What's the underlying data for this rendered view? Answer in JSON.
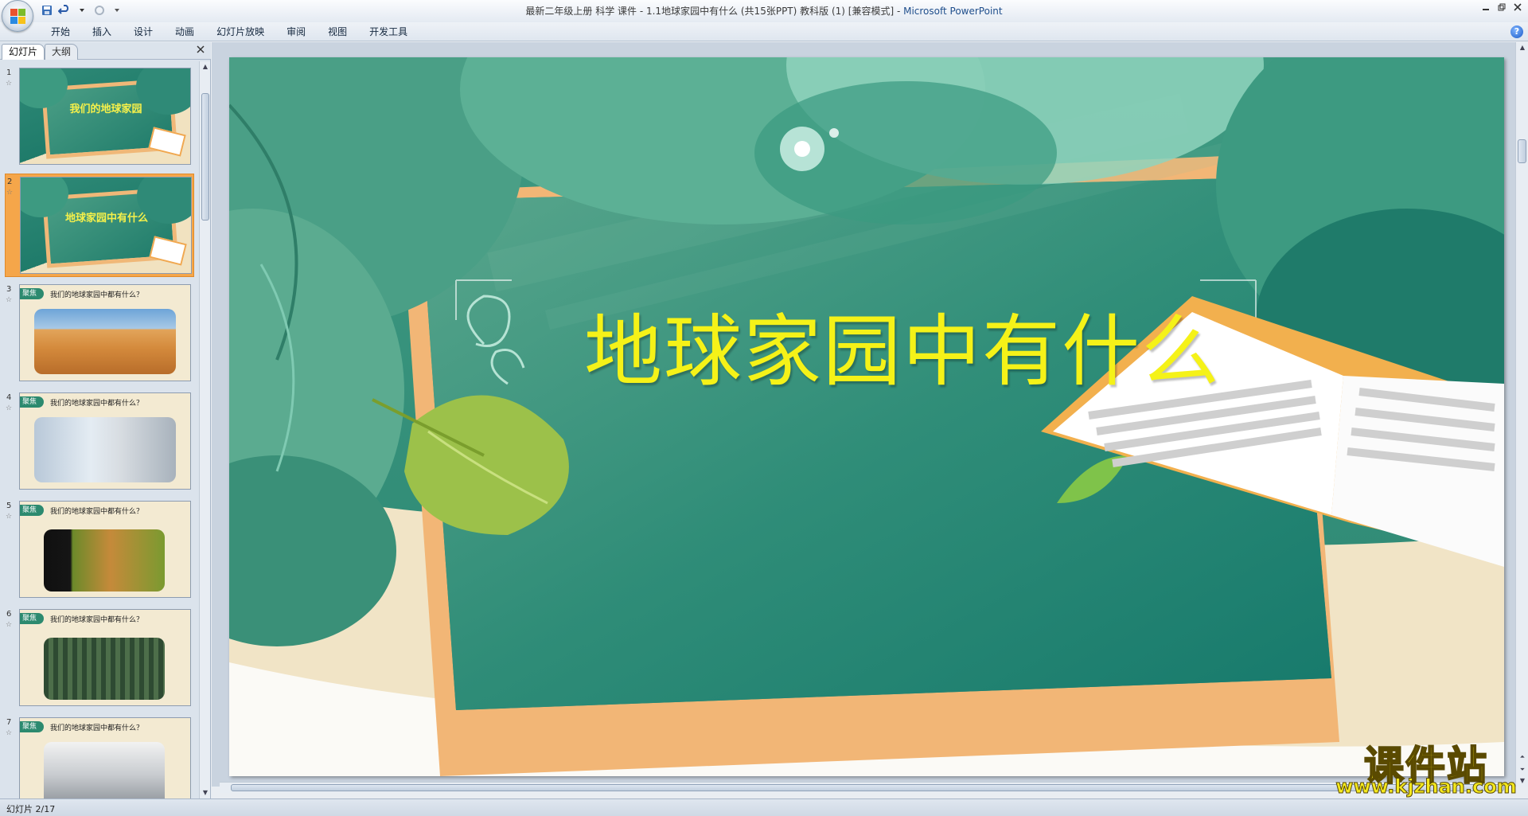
{
  "window": {
    "title": "最新二年级上册 科学 课件 - 1.1地球家园中有什么 (共15张PPT) 教科版 (1) [兼容模式]",
    "app_name": "Microsoft PowerPoint",
    "title_separator": " - "
  },
  "ribbon": {
    "tabs": [
      "开始",
      "插入",
      "设计",
      "动画",
      "幻灯片放映",
      "审阅",
      "视图",
      "开发工具"
    ]
  },
  "pane": {
    "tab_slides": "幻灯片",
    "tab_outline": "大纲"
  },
  "thumbnails": [
    {
      "num": "1",
      "title": "我们的地球家园",
      "type": "title"
    },
    {
      "num": "2",
      "title": "地球家园中有什么",
      "type": "title",
      "selected": true
    },
    {
      "num": "3",
      "tag": "聚焦",
      "title": "我们的地球家园中都有什么？",
      "photo": "desert"
    },
    {
      "num": "4",
      "tag": "聚焦",
      "title": "我们的地球家园中都有什么？",
      "photo": "classroom"
    },
    {
      "num": "5",
      "tag": "聚焦",
      "title": "我们的地球家园中都有什么？",
      "photo": "dogs"
    },
    {
      "num": "6",
      "tag": "聚焦",
      "title": "我们的地球家园中都有什么？",
      "photo": "forest"
    },
    {
      "num": "7",
      "tag": "聚焦",
      "title": "我们的地球家园中都有什么？",
      "photo": "mountains"
    }
  ],
  "slide": {
    "title": "地球家园中有什么",
    "colors": {
      "title": "#f5f218",
      "board": "#2f8d78",
      "frame": "#f2b676",
      "leaf": "#9cc14a"
    }
  },
  "statusbar": {
    "text": "幻灯片 2/17"
  },
  "watermark": {
    "cn": "课件站",
    "url": "www.kjzhan.com"
  }
}
